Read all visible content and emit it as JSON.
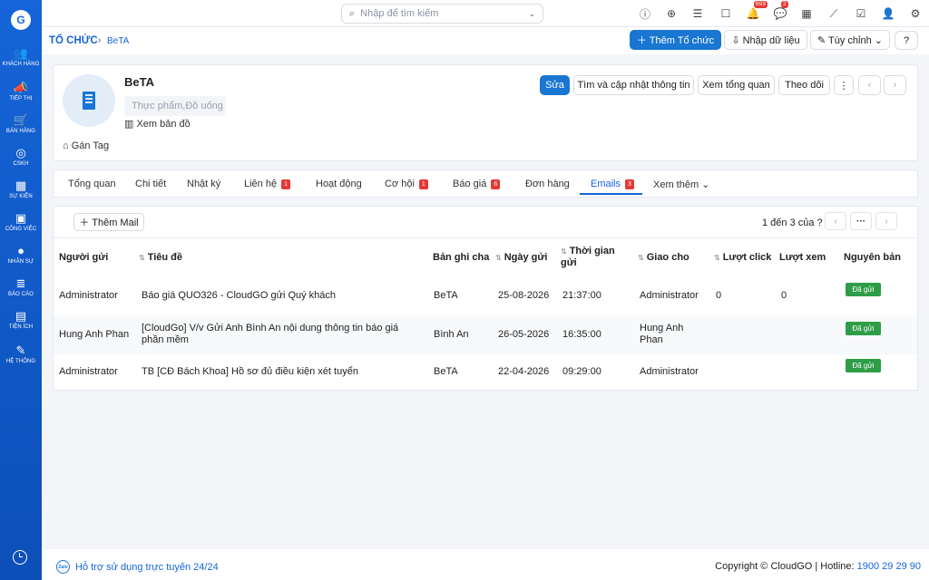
{
  "sidebar": {
    "logo_text": "G",
    "items": [
      {
        "label": "KHÁCH HÀNG",
        "icon": "👥",
        "icon_name": "customers-icon"
      },
      {
        "label": "TIẾP THỊ",
        "icon": "📣",
        "icon_name": "megaphone-icon"
      },
      {
        "label": "BÁN HÀNG",
        "icon": "🛒",
        "icon_name": "cart-icon"
      },
      {
        "label": "CSKH",
        "icon": "◎",
        "icon_name": "lifebuoy-icon"
      },
      {
        "label": "SỰ KIỆN",
        "icon": "▦",
        "icon_name": "calendar-icon"
      },
      {
        "label": "CÔNG VIỆC",
        "icon": "▣",
        "icon_name": "briefcase-icon"
      },
      {
        "label": "NHÂN SỰ",
        "icon": "●",
        "icon_name": "person-icon"
      },
      {
        "label": "BÁO CÁO",
        "icon": "≣",
        "icon_name": "report-icon"
      },
      {
        "label": "TIỆN ÍCH",
        "icon": "▤",
        "icon_name": "box-icon"
      },
      {
        "label": "HỆ THỐNG",
        "icon": "✎",
        "icon_name": "wrench-icon"
      }
    ]
  },
  "search": {
    "placeholder": "Nhập để tìm kiếm"
  },
  "topbar": {
    "notif_count": "693",
    "chat_count": "2"
  },
  "breadcrumb": {
    "root": "TỔ CHỨC",
    "sep": "›",
    "current": "BeTA"
  },
  "header": {
    "add_org": "＋ Thêm Tổ chức",
    "import": "⇩ Nhập dữ liệu",
    "customize": "✎ Tùy chỉnh ⌄",
    "help": "?"
  },
  "account": {
    "name": "BeTA",
    "tag": "Thực phẩm,Đồ uống",
    "map": "▥ Xem bản đồ",
    "gan_tag": "⌂ Gán Tag",
    "actions": {
      "edit": "Sửa",
      "find_update": "Tìm và cập nhật thông tin",
      "overview": "Xem tổng quan",
      "follow": "Theo dõi",
      "more": "⋮",
      "prev": "‹",
      "next": "›"
    }
  },
  "tabs": [
    {
      "label": "Tổng quan"
    },
    {
      "label": "Chi tiết"
    },
    {
      "label": "Nhật ký"
    },
    {
      "label": "Liên hệ",
      "count": "1"
    },
    {
      "label": "Hoạt động"
    },
    {
      "label": "Cơ hội",
      "count": "1"
    },
    {
      "label": "Báo giá",
      "count": "6"
    },
    {
      "label": "Đơn hàng"
    },
    {
      "label": "Emails",
      "count": "3"
    },
    {
      "label": "Xem thêm ⌄"
    }
  ],
  "emails": {
    "add_button": "＋ Thêm Mail",
    "pager_text": "1 đến 3 của ?",
    "pager_more": "···",
    "pager_prev": "‹",
    "pager_next": "›",
    "columns": {
      "sender": "Người gửi",
      "subject": "Tiêu đề",
      "parent": "Bản ghi cha",
      "date": "Ngày gửi",
      "time": "Thời gian gửi",
      "assignee": "Giao cho",
      "clicks": "Lượt click",
      "views": "Lượt xem",
      "original": "Nguyên bản"
    },
    "rows": [
      {
        "sender": "Administrator",
        "subject": "Báo giá QUO326 - CloudGO gửi Quý khách",
        "parent": "BeTA",
        "date": "25-08-2026",
        "time": "21:37:00",
        "assignee": "Administrator",
        "clicks": "0",
        "views": "0",
        "status": "Đã gửi"
      },
      {
        "sender": "Hung Anh Phan",
        "subject": "[CloudGo] V/v Gửi Anh Bình An nội dung thông tin báo giá phần mềm",
        "parent": "Bình An",
        "date": "26-05-2026",
        "time": "16:35:00",
        "assignee": "Hung Anh Phan",
        "clicks": "",
        "views": "",
        "status": "Đã gửi"
      },
      {
        "sender": "Administrator",
        "subject": "TB [CĐ Bách Khoa] Hồ sơ đủ điều kiện xét tuyển",
        "parent": "BeTA",
        "date": "22-04-2026",
        "time": "09:29:00",
        "assignee": "Administrator",
        "clicks": "",
        "views": "",
        "status": "Đã gửi"
      }
    ]
  },
  "footer": {
    "zalo": "Zalo",
    "support": "Hỗ trợ sử dụng trực tuyến 24/24",
    "copyright": "Copyright © CloudGO | Hotline: ",
    "hotline": "1900 29 29 90"
  }
}
